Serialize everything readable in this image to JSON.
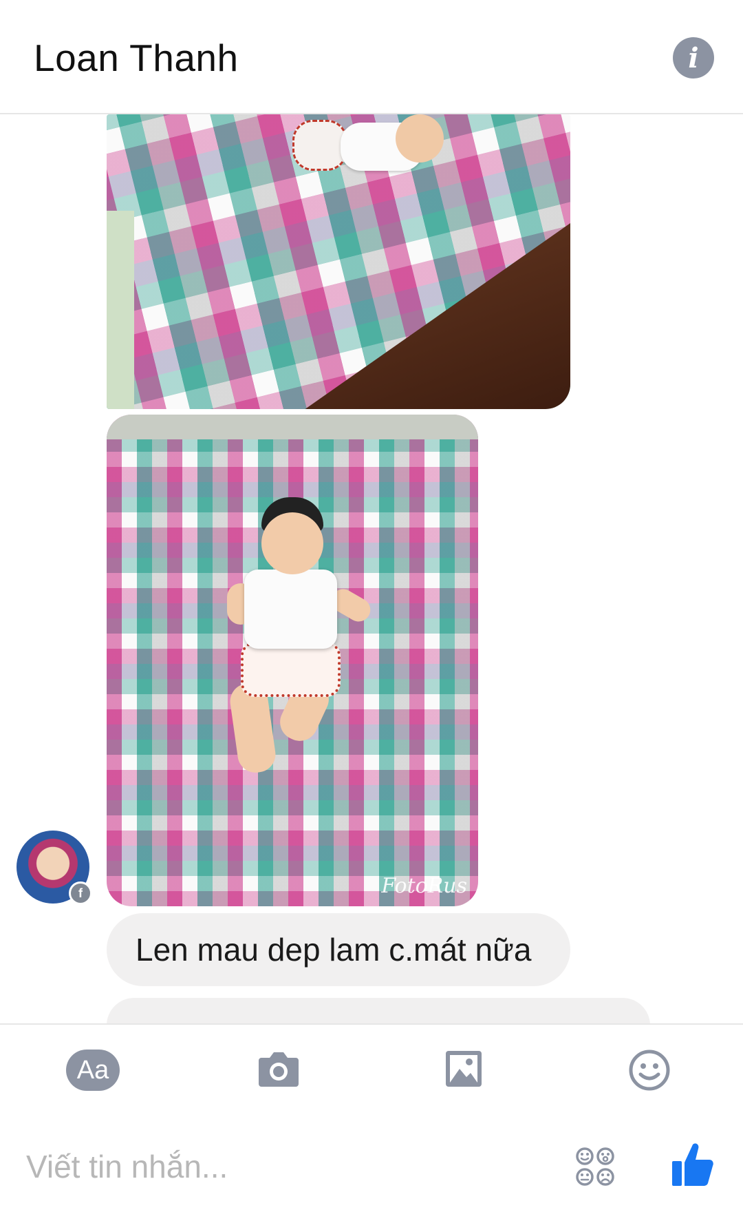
{
  "header": {
    "contact_name": "Loan Thanh",
    "info_icon": "info-icon"
  },
  "thread": {
    "photos": [
      {
        "description_icon": "photo",
        "watermark": ""
      },
      {
        "description_icon": "photo",
        "watermark": "FotoRus"
      }
    ],
    "messages": [
      {
        "text": "Len mau dep lam c.mát nữa"
      }
    ],
    "avatar_badge": "f"
  },
  "composer": {
    "aa_label": "Aa",
    "placeholder": "Viết tin nhắn...",
    "icons": [
      "text-format-icon",
      "camera-icon",
      "image-icon",
      "emoji-icon",
      "stickers-icon",
      "like-icon"
    ]
  },
  "colors": {
    "icon_gray": "#8c93a2",
    "messenger_blue": "#1877f2",
    "bubble_gray": "#f1f0f0"
  }
}
